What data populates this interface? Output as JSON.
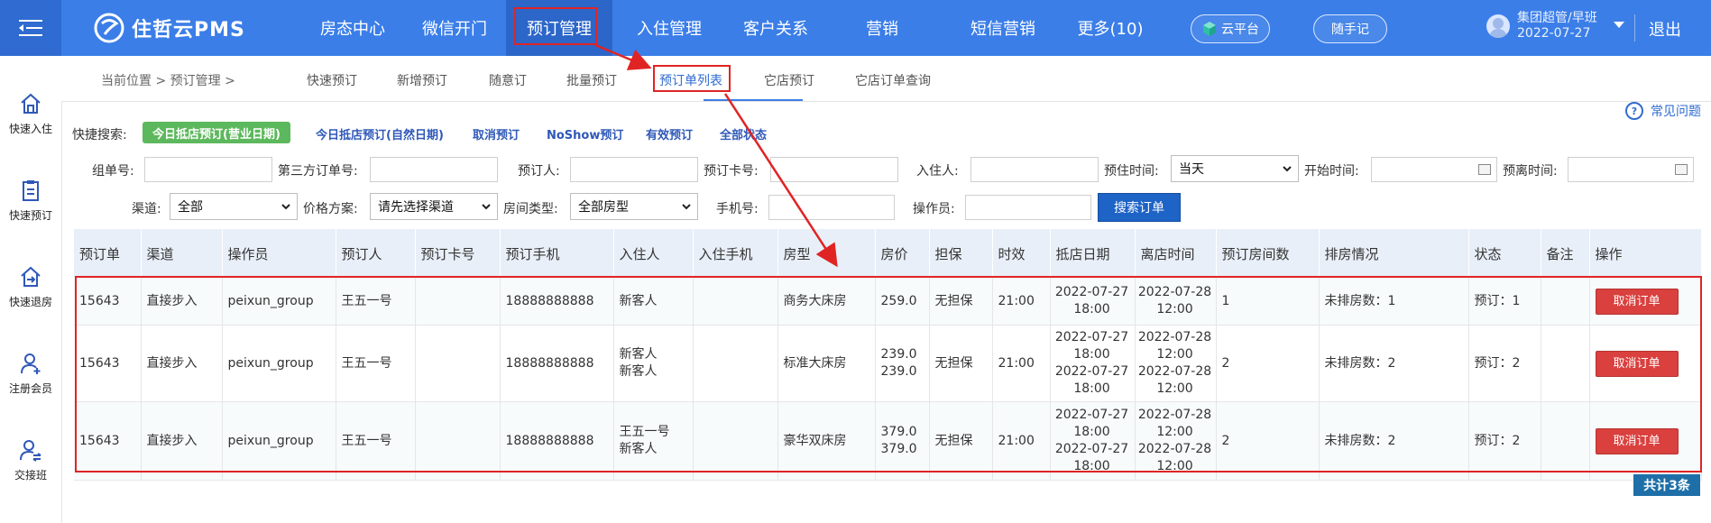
{
  "app": {
    "title": "住哲云PMS"
  },
  "nav": {
    "items": [
      "房态中心",
      "微信开门",
      "预订管理",
      "入住管理",
      "客户关系",
      "营销",
      "短信营销",
      "更多(10)"
    ],
    "active_index": 2
  },
  "header": {
    "cloud_platform": "云平台",
    "notes": "随手记",
    "user_name": "集团超管/早班",
    "user_date": "2022-07-27",
    "logout": "退出"
  },
  "sidebar": {
    "items": [
      "快速入住",
      "快速预订",
      "快速退房",
      "注册会员",
      "交接班"
    ]
  },
  "breadcrumb": {
    "text": "当前位置 > 预订管理 >"
  },
  "subtabs": {
    "items": [
      "快速预订",
      "新增预订",
      "随意订",
      "批量预订",
      "预订单列表",
      "它店预订",
      "它店订单查询"
    ],
    "active_index": 4
  },
  "faq": "常见问题",
  "quick_search": {
    "label": "快捷搜索:",
    "active": "今日抵店预订(营业日期)",
    "links": [
      "今日抵店预订(自然日期)",
      "取消预订",
      "NoShow预订",
      "有效预订",
      "全部状态"
    ]
  },
  "filters": {
    "group_no": "组单号:",
    "third_party_no": "第三方订单号:",
    "booker": "预订人:",
    "booking_card": "预订卡号:",
    "guest": "入住人:",
    "stay_time": "预住时间:",
    "stay_time_value": "当天",
    "start_time": "开始时间:",
    "leave_time": "预离时间:",
    "channel": "渠道:",
    "channel_value": "全部",
    "price_plan": "价格方案:",
    "price_plan_value": "请先选择渠道",
    "room_type": "房间类型:",
    "room_type_value": "全部房型",
    "phone": "手机号:",
    "operator": "操作员:",
    "search_button": "搜索订单"
  },
  "table": {
    "headers": [
      "预订单",
      "渠道",
      "操作员",
      "预订人",
      "预订卡号",
      "预订手机",
      "入住人",
      "入住手机",
      "房型",
      "房价",
      "担保",
      "时效",
      "抵店日期",
      "离店时间",
      "预订房间数",
      "排房情况",
      "状态",
      "备注",
      "操作"
    ],
    "rows": [
      {
        "order": "15643",
        "channel": "直接步入",
        "operator": "peixun_group",
        "booker": "王五一号",
        "card": "",
        "phone": "18888888888",
        "guest1": "新客人",
        "guest2": "",
        "guest_phone": "",
        "room_type": "商务大床房",
        "price1": "259.0",
        "price2": "",
        "guarantee": "无担保",
        "validity": "21:00",
        "arr1": "2022-07-27",
        "arr2": "18:00",
        "arr3": "",
        "arr4": "",
        "dep1": "2022-07-28",
        "dep2": "12:00",
        "dep3": "",
        "dep4": "",
        "rooms": "1",
        "assign": "未排房数：1",
        "status": "预订：1",
        "remark": "",
        "action": "取消订单"
      },
      {
        "order": "15643",
        "channel": "直接步入",
        "operator": "peixun_group",
        "booker": "王五一号",
        "card": "",
        "phone": "18888888888",
        "guest1": "新客人",
        "guest2": "新客人",
        "guest_phone": "",
        "room_type": "标准大床房",
        "price1": "239.0",
        "price2": "239.0",
        "guarantee": "无担保",
        "validity": "21:00",
        "arr1": "2022-07-27",
        "arr2": "18:00",
        "arr3": "2022-07-27",
        "arr4": "18:00",
        "dep1": "2022-07-28",
        "dep2": "12:00",
        "dep3": "2022-07-28",
        "dep4": "12:00",
        "rooms": "2",
        "assign": "未排房数：2",
        "status": "预订：2",
        "remark": "",
        "action": "取消订单"
      },
      {
        "order": "15643",
        "channel": "直接步入",
        "operator": "peixun_group",
        "booker": "王五一号",
        "card": "",
        "phone": "18888888888",
        "guest1": "王五一号",
        "guest2": "新客人",
        "guest_phone": "",
        "room_type": "豪华双床房",
        "price1": "379.0",
        "price2": "379.0",
        "guarantee": "无担保",
        "validity": "21:00",
        "arr1": "2022-07-27",
        "arr2": "18:00",
        "arr3": "2022-07-27",
        "arr4": "18:00",
        "dep1": "2022-07-28",
        "dep2": "12:00",
        "dep3": "2022-07-28",
        "dep4": "12:00",
        "rooms": "2",
        "assign": "未排房数：2",
        "status": "预订：2",
        "remark": "",
        "action": "取消订单"
      }
    ]
  },
  "total": "共计3条",
  "colors": {
    "primary": "#3b7ee8",
    "danger": "#d9403e",
    "success": "#5cb85c",
    "annotation": "#e02424"
  }
}
